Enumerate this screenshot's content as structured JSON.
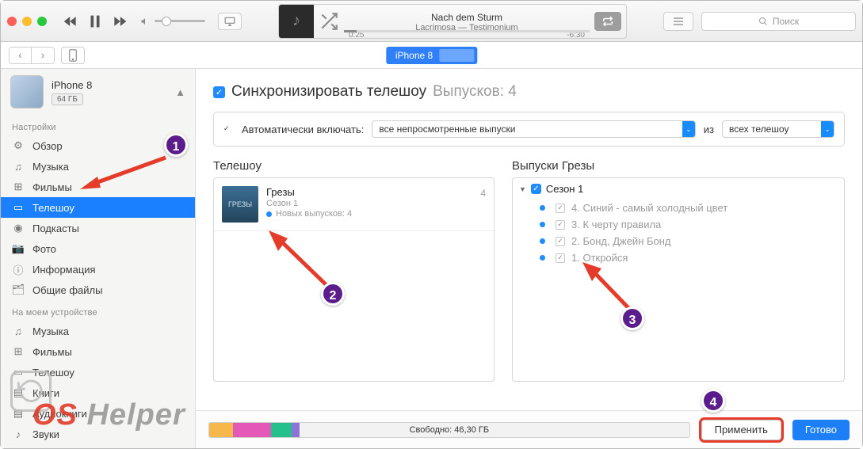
{
  "player": {
    "now_playing": {
      "title": "Nach dem Sturm",
      "artist_album": "Lacrimosa — Testimonium",
      "elapsed": "0:25",
      "remaining": "-6:30"
    }
  },
  "search": {
    "placeholder": "Поиск"
  },
  "tab": {
    "label": "iPhone 8"
  },
  "device": {
    "name": "iPhone 8",
    "capacity": "64 ГБ"
  },
  "sidebar": {
    "section1": "Настройки",
    "items1": [
      {
        "icon": "gear",
        "label": "Обзор"
      },
      {
        "icon": "music",
        "label": "Музыка"
      },
      {
        "icon": "film",
        "label": "Фильмы"
      },
      {
        "icon": "tv",
        "label": "Телешоу"
      },
      {
        "icon": "podcast",
        "label": "Подкасты"
      },
      {
        "icon": "photo",
        "label": "Фото"
      },
      {
        "icon": "info",
        "label": "Информация"
      },
      {
        "icon": "files",
        "label": "Общие файлы"
      }
    ],
    "section2": "На моем устройстве",
    "items2": [
      {
        "icon": "music",
        "label": "Музыка"
      },
      {
        "icon": "film",
        "label": "Фильмы"
      },
      {
        "icon": "tv",
        "label": "Телешоу"
      },
      {
        "icon": "book",
        "label": "Книги"
      },
      {
        "icon": "audiobook",
        "label": "Аудиокниги"
      },
      {
        "icon": "tone",
        "label": "Звуки"
      }
    ]
  },
  "main": {
    "sync_label": "Синхронизировать телешоу",
    "episodes_label": "Выпусков: 4",
    "auto_include": "Автоматически включать:",
    "select1": "все непросмотренные выпуски",
    "of": "из",
    "select2": "всех телешоу",
    "col_left": "Телешоу",
    "col_right": "Выпуски Грезы",
    "show": {
      "title": "Грезы",
      "season": "Сезон 1",
      "new": "Новых выпусков: 4",
      "count": "4"
    },
    "season_label": "Сезон 1",
    "episodes": [
      "4. Синий - самый холодный цвет",
      "3. К черту правила",
      "2. Бонд, Джейн Бонд",
      "1. Откройся"
    ]
  },
  "bottom": {
    "free": "Свободно: 46,30 ГБ",
    "apply": "Применить",
    "done": "Готово"
  },
  "markers": [
    "1",
    "2",
    "3",
    "4"
  ],
  "watermark": {
    "a": "OS",
    "b": " Helper"
  }
}
